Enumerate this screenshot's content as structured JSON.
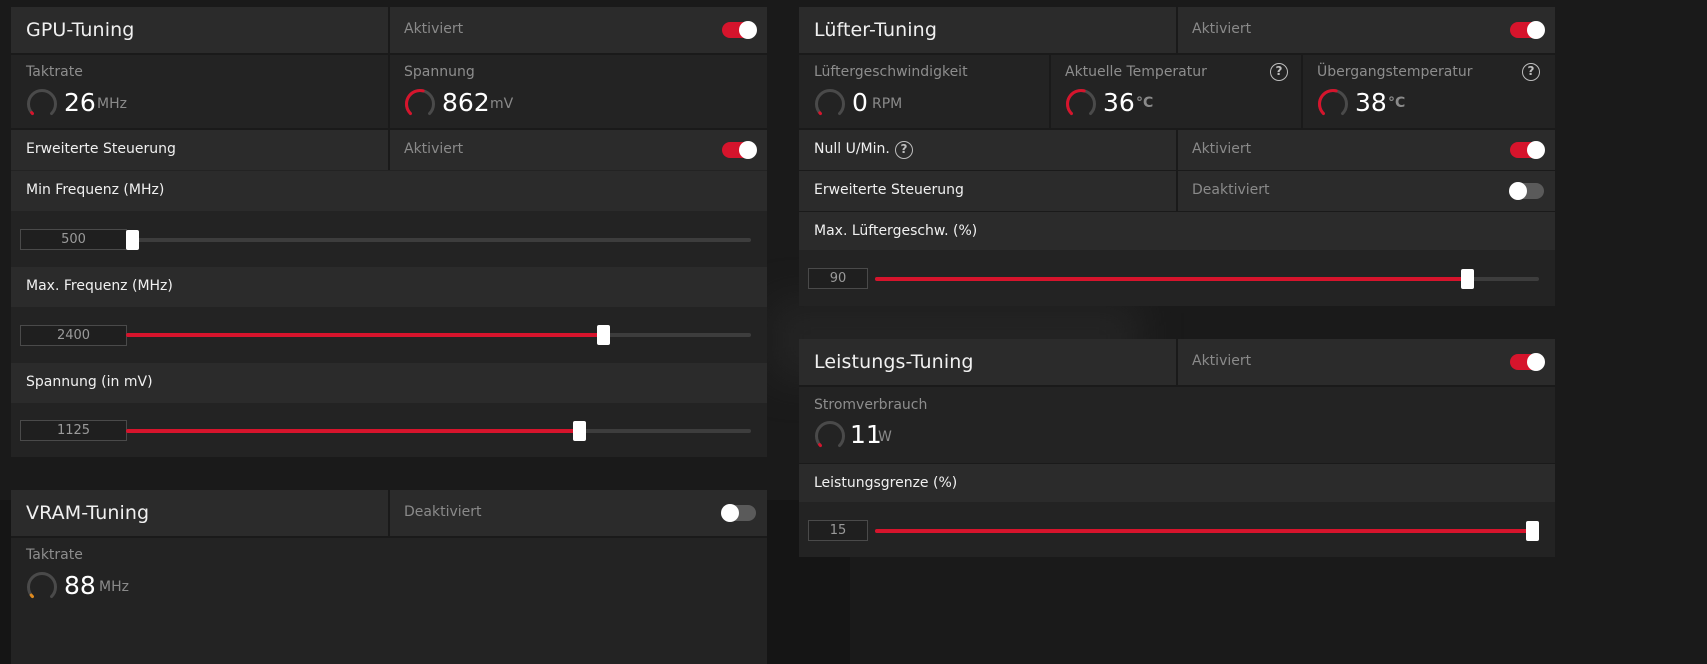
{
  "gpu_tuning": {
    "title": "GPU-Tuning",
    "status": "Aktiviert",
    "toggle_on": true,
    "clock": {
      "label": "Taktrate",
      "value": "26",
      "unit": "MHz",
      "gauge_fraction": 0.02
    },
    "voltage": {
      "label": "Spannung",
      "value": "862",
      "unit": "mV",
      "gauge_fraction": 0.55
    },
    "advanced": {
      "label": "Erweiterte Steuerung",
      "status": "Aktiviert",
      "toggle_on": true
    },
    "min_freq": {
      "label": "Min Frequenz (MHz)",
      "value": "500",
      "fraction": 0.0
    },
    "max_freq": {
      "label": "Max. Frequenz (MHz)",
      "value": "2400",
      "fraction": 0.77
    },
    "voltage_slider": {
      "label": "Spannung (in mV)",
      "value": "1125",
      "fraction": 0.73
    }
  },
  "vram_tuning": {
    "title": "VRAM-Tuning",
    "status": "Deaktiviert",
    "toggle_on": false,
    "clock": {
      "label": "Taktrate",
      "value": "88",
      "unit": "MHz",
      "gauge_fraction": 0.03
    }
  },
  "fan_tuning": {
    "title": "Lüfter-Tuning",
    "status": "Aktiviert",
    "toggle_on": true,
    "fan_speed": {
      "label": "Lüftergeschwindigkeit",
      "value": "0",
      "unit": "RPM",
      "gauge_fraction": 0.0
    },
    "current_temp": {
      "label": "Aktuelle Temperatur",
      "value": "36",
      "unit": "°C",
      "gauge_fraction": 0.55
    },
    "junction_temp": {
      "label": "Übergangstemperatur",
      "value": "38",
      "unit": "°C",
      "gauge_fraction": 0.55
    },
    "zero_rpm": {
      "label": "Null U/Min.",
      "status": "Aktiviert",
      "toggle_on": true
    },
    "advanced": {
      "label": "Erweiterte Steuerung",
      "status": "Deaktiviert",
      "toggle_on": false
    },
    "max_fan_speed": {
      "label": "Max. Lüftergeschw. (%)",
      "value": "90",
      "fraction": 0.9
    }
  },
  "power_tuning": {
    "title": "Leistungs-Tuning",
    "status": "Aktiviert",
    "toggle_on": true,
    "power_draw": {
      "label": "Stromverbrauch",
      "value": "11",
      "unit": "W",
      "gauge_fraction": 0.02
    },
    "power_limit": {
      "label": "Leistungsgrenze (%)",
      "value": "15",
      "fraction": 1.0
    }
  },
  "colors": {
    "accent": "#d6142c",
    "panel": "#232323",
    "row": "#2b2b2b",
    "background": "#1a1a1a"
  },
  "icons": {
    "help": "question-circle-icon",
    "gauge": "ring-gauge-icon"
  }
}
